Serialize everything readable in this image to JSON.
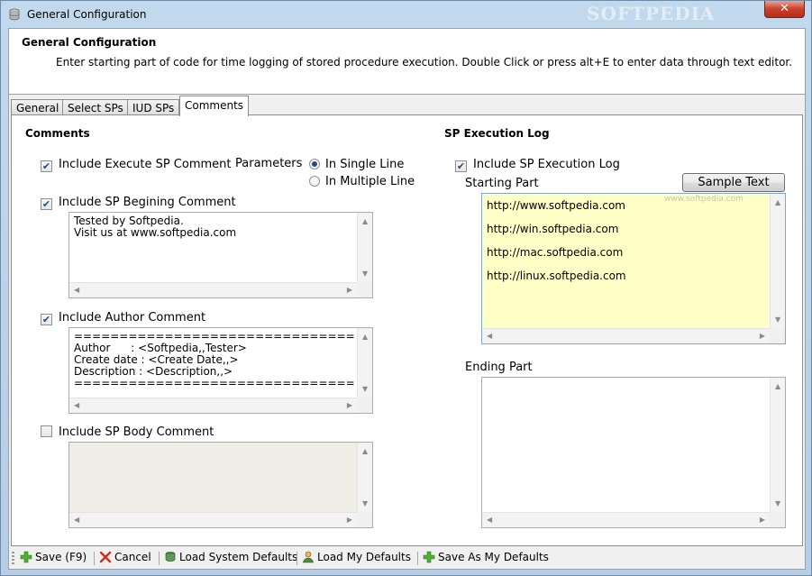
{
  "window": {
    "title": "General Configuration",
    "watermark": "SOFTPEDIA",
    "close_glyph": "✕"
  },
  "header": {
    "title": "General Configuration",
    "description": "Enter starting part of code for time logging of stored procedure execution. Double Click or press alt+E to enter data through text editor."
  },
  "tabs": [
    {
      "label": "General"
    },
    {
      "label": "Select SPs"
    },
    {
      "label": "IUD SPs"
    },
    {
      "label": "Comments",
      "active": true
    }
  ],
  "comments": {
    "title": "Comments",
    "execute": {
      "label": "Include Execute SP Comment",
      "checked": true
    },
    "parameters": {
      "label": "Parameters",
      "options": [
        {
          "label": "In Single Line",
          "selected": true
        },
        {
          "label": "In Multiple Line",
          "selected": false
        }
      ]
    },
    "beginning": {
      "label": "Include SP Begining Comment",
      "checked": true,
      "text": "Tested by Softpedia.\nVisit us at www.softpedia.com"
    },
    "author": {
      "label": "Include Author Comment",
      "checked": true,
      "text": "==================================\nAuthor      : <Softpedia,,Tester>\nCreate date : <Create Date,,>\nDescription : <Description,,>\n=================================="
    },
    "body": {
      "label": "Include SP Body Comment",
      "checked": false,
      "text": ""
    }
  },
  "sp_log": {
    "title": "SP Execution Log",
    "include": {
      "label": "Include SP Execution Log",
      "checked": true
    },
    "starting_label": "Starting Part",
    "sample_button": "Sample Text",
    "starting_text": "http://www.softpedia.com\nhttp://win.softpedia.com\nhttp://mac.softpedia.com\nhttp://linux.softpedia.com",
    "ending_label": "Ending Part",
    "ending_text": "",
    "field_watermark": "www.softpedia.com"
  },
  "footer": {
    "save": "Save (F9)",
    "cancel": "Cancel",
    "load_system": "Load System Defaults",
    "load_my": "Load My Defaults",
    "save_as_my": "Save As My Defaults"
  },
  "colors": {
    "accent": "#2a4a7a",
    "highlight_field": "#ffffc8",
    "frame": "#b6cde3"
  }
}
